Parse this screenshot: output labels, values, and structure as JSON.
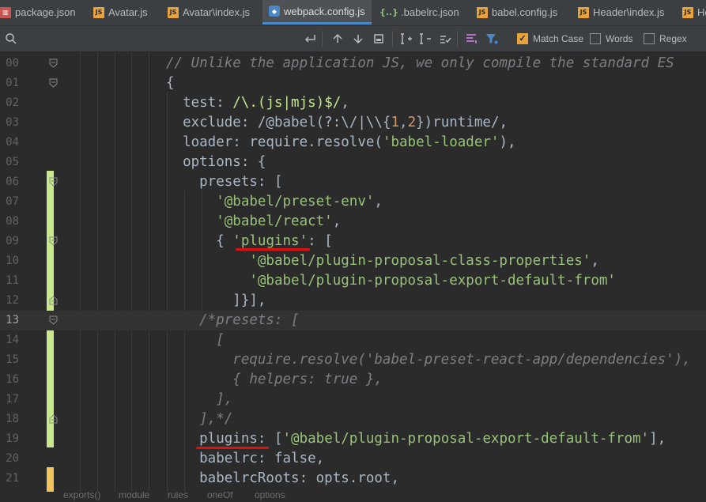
{
  "tabs": [
    {
      "label": "package.json",
      "icon": "package-json-icon"
    },
    {
      "label": "Avatar.js",
      "icon": "js-file-icon"
    },
    {
      "label": "Avatar\\index.js",
      "icon": "js-file-icon"
    },
    {
      "label": "webpack.config.js",
      "icon": "webpack-config-icon",
      "active": true
    },
    {
      "label": ".babelrc.json",
      "icon": "json-file-icon"
    },
    {
      "label": "babel.config.js",
      "icon": "js-file-icon"
    },
    {
      "label": "Header\\index.js",
      "icon": "js-file-icon"
    },
    {
      "label": "He",
      "icon": "js-file-icon"
    }
  ],
  "find": {
    "query": "",
    "match_case_label": "Match Case",
    "match_case_checked": true,
    "words_label": "Words",
    "words_checked": false,
    "regex_label": "Regex",
    "regex_checked": false
  },
  "line_numbers": [
    "00",
    "01",
    "02",
    "03",
    "04",
    "05",
    "06",
    "07",
    "08",
    "09",
    "10",
    "11",
    "12",
    "13",
    "14",
    "15",
    "16",
    "17",
    "18",
    "19",
    "20",
    "21"
  ],
  "code_lines": [
    "// Unlike the application JS, we only compile the standard ES",
    "{",
    "  test: /\\.(js|mjs)$/,",
    "  exclude: /@babel(?:\\/|\\\\{1,2})runtime/,",
    "  loader: require.resolve('babel-loader'),",
    "  options: {",
    "    presets: [",
    "      '@babel/preset-env',",
    "      '@babel/react',",
    "      { 'plugins': [",
    "          '@babel/plugin-proposal-class-properties',",
    "          '@babel/plugin-proposal-export-default-from'",
    "        ]}],",
    "    /*presets: [",
    "      [",
    "        require.resolve('babel-preset-react-app/dependencies'),",
    "        { helpers: true },",
    "      ],",
    "    ],*/",
    "    plugins: ['@babel/plugin-proposal-export-default-from'],",
    "    babelrc: false,",
    "    babelrcRoots: opts.root,"
  ],
  "breadcrumbs": [
    "exports()",
    "module",
    "rules",
    "oneOf",
    "options"
  ],
  "colors": {
    "change_bar": "#c9e88b",
    "modified_bar": "#f2c55c",
    "active_tab_underline": "#4a88c7",
    "match_case_check": "#e8a33d"
  }
}
